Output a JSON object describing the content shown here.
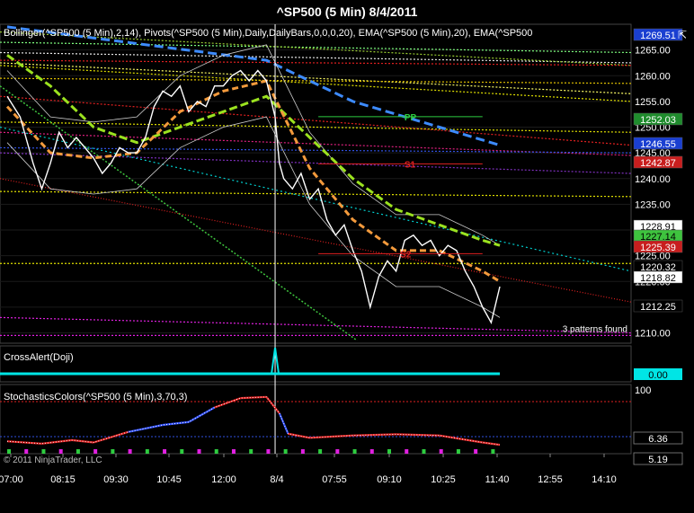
{
  "title": "^SP500 (5 Min)  8/4/2011",
  "price_panel": {
    "indicator_label": "Bollinger(^SP500 (5 Min),2,14), Pivots(^SP500 (5 Min),Daily,DailyBars,0,0,0,20), EMA(^SP500 (5 Min),20), EMA(^SP500",
    "ticks": [
      "1265.00",
      "1260.00",
      "1255.00",
      "1250.00",
      "1245.00",
      "1240.00",
      "1235.00",
      "1230.00",
      "1225.00",
      "1220.00",
      "1215.00",
      "1210.00"
    ],
    "pivot_labels": {
      "pp": "PP",
      "s1": "S1",
      "s2": "S2"
    },
    "patterns_note": "3 patterns found",
    "tags": [
      {
        "value": "1269.51",
        "color": "#1a3fd1",
        "text_color": "#ffffff"
      },
      {
        "value": "1252.03",
        "color": "#1f8c2d",
        "text_color": "#ffffff"
      },
      {
        "value": "1246.55",
        "color": "#1a3fd1",
        "text_color": "#ffffff"
      },
      {
        "value": "1242.87",
        "color": "#c81e1e",
        "text_color": "#ffffff"
      },
      {
        "value": "1228.91",
        "color": "#ffffff",
        "text_color": "#000000"
      },
      {
        "value": "1227.14",
        "color": "#3ec33e",
        "text_color": "#000000"
      },
      {
        "value": "1225.39",
        "color": "#c81e1e",
        "text_color": "#ffffff"
      },
      {
        "value": "1220.32",
        "color": "#000000",
        "text_color": "#ffffff"
      },
      {
        "value": "1218.82",
        "color": "#ffffff",
        "text_color": "#000000"
      },
      {
        "value": "1212.25",
        "color": "#000000",
        "text_color": "#ffffff"
      }
    ]
  },
  "cross_panel": {
    "label": "CrossAlert(Doji)",
    "tag": "0.00",
    "tag_color": "#00e5e5"
  },
  "stoch_panel": {
    "label": "StochasticsColors(^SP500 (5 Min),3,70,3)",
    "tick": "100",
    "tags": [
      {
        "value": "6.36",
        "color": "#000000",
        "text_color": "#ffffff"
      },
      {
        "value": "5.19",
        "color": "#000000",
        "text_color": "#ffffff"
      }
    ],
    "copyright": "© 2011 NinjaTrader, LLC"
  },
  "chart_data": {
    "type": "line",
    "title": "^SP500 (5 Min)  8/4/2011",
    "x_ticks": [
      "07:00",
      "08:15",
      "09:30",
      "10:45",
      "12:00",
      "8/4",
      "07:55",
      "09:10",
      "10:25",
      "11:40",
      "12:55",
      "14:10"
    ],
    "ylim": [
      1208,
      1270
    ],
    "price_series": [
      {
        "t": 0,
        "v": 1256
      },
      {
        "t": 3,
        "v": 1252
      },
      {
        "t": 6,
        "v": 1243
      },
      {
        "t": 8,
        "v": 1238
      },
      {
        "t": 10,
        "v": 1243
      },
      {
        "t": 12,
        "v": 1249
      },
      {
        "t": 14,
        "v": 1246
      },
      {
        "t": 16,
        "v": 1248
      },
      {
        "t": 18,
        "v": 1246
      },
      {
        "t": 20,
        "v": 1244
      },
      {
        "t": 22,
        "v": 1241
      },
      {
        "t": 24,
        "v": 1243
      },
      {
        "t": 26,
        "v": 1246
      },
      {
        "t": 28,
        "v": 1245
      },
      {
        "t": 30,
        "v": 1245
      },
      {
        "t": 32,
        "v": 1248
      },
      {
        "t": 34,
        "v": 1254
      },
      {
        "t": 36,
        "v": 1257
      },
      {
        "t": 38,
        "v": 1256
      },
      {
        "t": 40,
        "v": 1258
      },
      {
        "t": 42,
        "v": 1253
      },
      {
        "t": 44,
        "v": 1255
      },
      {
        "t": 46,
        "v": 1254
      },
      {
        "t": 48,
        "v": 1258
      },
      {
        "t": 50,
        "v": 1258
      },
      {
        "t": 52,
        "v": 1260
      },
      {
        "t": 54,
        "v": 1261
      },
      {
        "t": 56,
        "v": 1259
      },
      {
        "t": 58,
        "v": 1261
      },
      {
        "t": 60,
        "v": 1259
      },
      {
        "t": 62,
        "v": 1252
      },
      {
        "t": 63,
        "v": 1243
      },
      {
        "t": 64,
        "v": 1240
      },
      {
        "t": 66,
        "v": 1238
      },
      {
        "t": 68,
        "v": 1241
      },
      {
        "t": 70,
        "v": 1236
      },
      {
        "t": 72,
        "v": 1238
      },
      {
        "t": 74,
        "v": 1232
      },
      {
        "t": 76,
        "v": 1229
      },
      {
        "t": 78,
        "v": 1231
      },
      {
        "t": 80,
        "v": 1226
      },
      {
        "t": 82,
        "v": 1222
      },
      {
        "t": 84,
        "v": 1215
      },
      {
        "t": 86,
        "v": 1221
      },
      {
        "t": 88,
        "v": 1224
      },
      {
        "t": 90,
        "v": 1222
      },
      {
        "t": 92,
        "v": 1228
      },
      {
        "t": 94,
        "v": 1229
      },
      {
        "t": 96,
        "v": 1227
      },
      {
        "t": 98,
        "v": 1228
      },
      {
        "t": 100,
        "v": 1225
      },
      {
        "t": 102,
        "v": 1227
      },
      {
        "t": 104,
        "v": 1226
      },
      {
        "t": 106,
        "v": 1222
      },
      {
        "t": 108,
        "v": 1219
      },
      {
        "t": 110,
        "v": 1215
      },
      {
        "t": 112,
        "v": 1212
      },
      {
        "t": 114,
        "v": 1219
      }
    ],
    "ema_orange": [
      {
        "t": 0,
        "v": 1254
      },
      {
        "t": 10,
        "v": 1245
      },
      {
        "t": 20,
        "v": 1244
      },
      {
        "t": 30,
        "v": 1245
      },
      {
        "t": 40,
        "v": 1253
      },
      {
        "t": 50,
        "v": 1257
      },
      {
        "t": 60,
        "v": 1259
      },
      {
        "t": 70,
        "v": 1242
      },
      {
        "t": 80,
        "v": 1232
      },
      {
        "t": 90,
        "v": 1226
      },
      {
        "t": 100,
        "v": 1226
      },
      {
        "t": 110,
        "v": 1222
      },
      {
        "t": 114,
        "v": 1220
      }
    ],
    "ema_green": [
      {
        "t": 0,
        "v": 1264
      },
      {
        "t": 10,
        "v": 1258
      },
      {
        "t": 20,
        "v": 1250
      },
      {
        "t": 30,
        "v": 1247
      },
      {
        "t": 40,
        "v": 1250
      },
      {
        "t": 50,
        "v": 1253
      },
      {
        "t": 60,
        "v": 1256
      },
      {
        "t": 70,
        "v": 1248
      },
      {
        "t": 80,
        "v": 1240
      },
      {
        "t": 90,
        "v": 1234
      },
      {
        "t": 100,
        "v": 1231
      },
      {
        "t": 110,
        "v": 1228
      },
      {
        "t": 114,
        "v": 1227
      }
    ],
    "blue_ema": [
      {
        "t": 0,
        "v": 1269.5
      },
      {
        "t": 60,
        "v": 1263
      },
      {
        "t": 80,
        "v": 1255
      },
      {
        "t": 100,
        "v": 1250
      },
      {
        "t": 114,
        "v": 1246.5
      }
    ],
    "pivot_levels": [
      {
        "name": "PP",
        "v": 1252.03,
        "color": "#2ecc40"
      },
      {
        "name": "S1",
        "v": 1242.87,
        "color": "#e02020"
      },
      {
        "name": "S2",
        "v": 1225.39,
        "color": "#e02020"
      }
    ],
    "cross_alert": [
      {
        "t": 62,
        "v": 1
      }
    ],
    "stochastic": [
      {
        "t": 0,
        "v": 12
      },
      {
        "t": 8,
        "v": 8
      },
      {
        "t": 15,
        "v": 14
      },
      {
        "t": 20,
        "v": 10
      },
      {
        "t": 28,
        "v": 28
      },
      {
        "t": 36,
        "v": 40
      },
      {
        "t": 42,
        "v": 45
      },
      {
        "t": 48,
        "v": 70
      },
      {
        "t": 54,
        "v": 86
      },
      {
        "t": 60,
        "v": 88
      },
      {
        "t": 63,
        "v": 60
      },
      {
        "t": 65,
        "v": 25
      },
      {
        "t": 70,
        "v": 18
      },
      {
        "t": 80,
        "v": 22
      },
      {
        "t": 90,
        "v": 24
      },
      {
        "t": 100,
        "v": 22
      },
      {
        "t": 110,
        "v": 10
      },
      {
        "t": 114,
        "v": 6
      }
    ]
  }
}
